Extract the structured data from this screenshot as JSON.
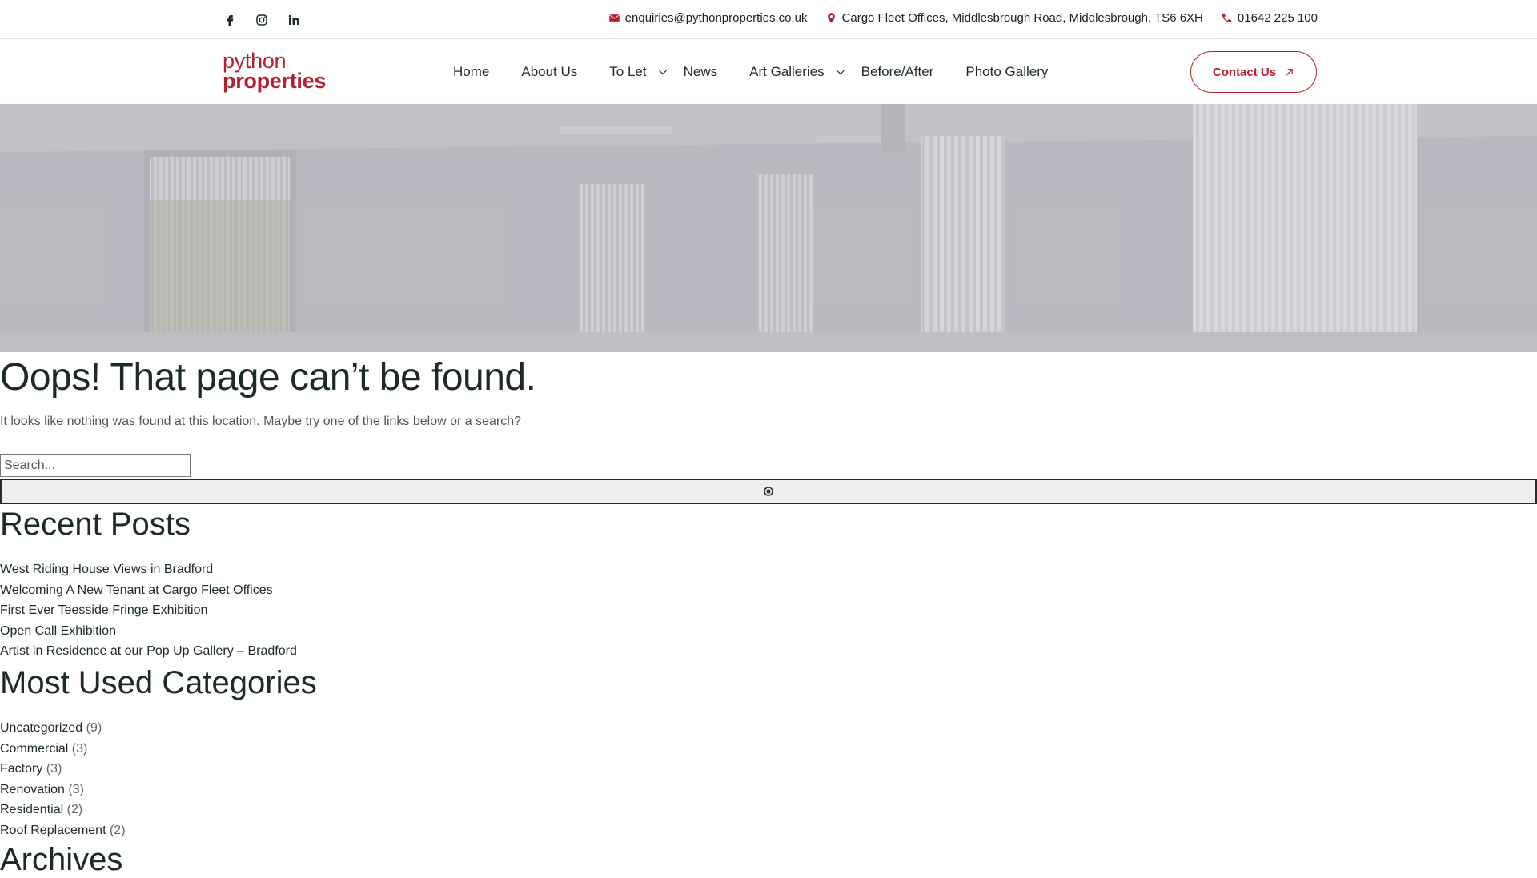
{
  "topbar": {
    "social": [
      "facebook-icon",
      "instagram-icon",
      "linkedin-icon"
    ],
    "email": "enquiries@pythonproperties.co.uk",
    "address": "Cargo Fleet Offices, Middlesbrough Road, Middlesbrough, TS6 6XH",
    "phone": "01642 225 100"
  },
  "nav": {
    "logo_line1": "python",
    "logo_line2": "properties",
    "items": [
      "Home",
      "About Us",
      "To Let",
      "News",
      "Art Galleries",
      "Before/After",
      "Photo Gallery"
    ],
    "contact_label": "Contact Us"
  },
  "colors": {
    "brand": "#b5202e",
    "text": "#1d2a2a"
  },
  "main": {
    "title": "Oops! That page can’t be found.",
    "lead": "It looks like nothing was found at this location. Maybe try one of the links below or a search?",
    "search_placeholder": "Search...",
    "recent_title": "Recent Posts",
    "recent_posts": [
      "West Riding House Views in Bradford",
      "Welcoming A New Tenant at Cargo Fleet Offices",
      "First Ever Teesside Fringe Exhibition",
      "Open Call Exhibition",
      "Artist in Residence at our Pop Up Gallery – Bradford"
    ],
    "categories_title": "Most Used Categories",
    "categories": [
      {
        "name": "Uncategorized",
        "count": "(9)"
      },
      {
        "name": "Commercial",
        "count": "(3)"
      },
      {
        "name": "Factory",
        "count": "(3)"
      },
      {
        "name": "Renovation",
        "count": "(3)"
      },
      {
        "name": "Residential",
        "count": "(2)"
      },
      {
        "name": "Roof Replacement",
        "count": "(2)"
      }
    ],
    "archives_title": "Archives"
  }
}
